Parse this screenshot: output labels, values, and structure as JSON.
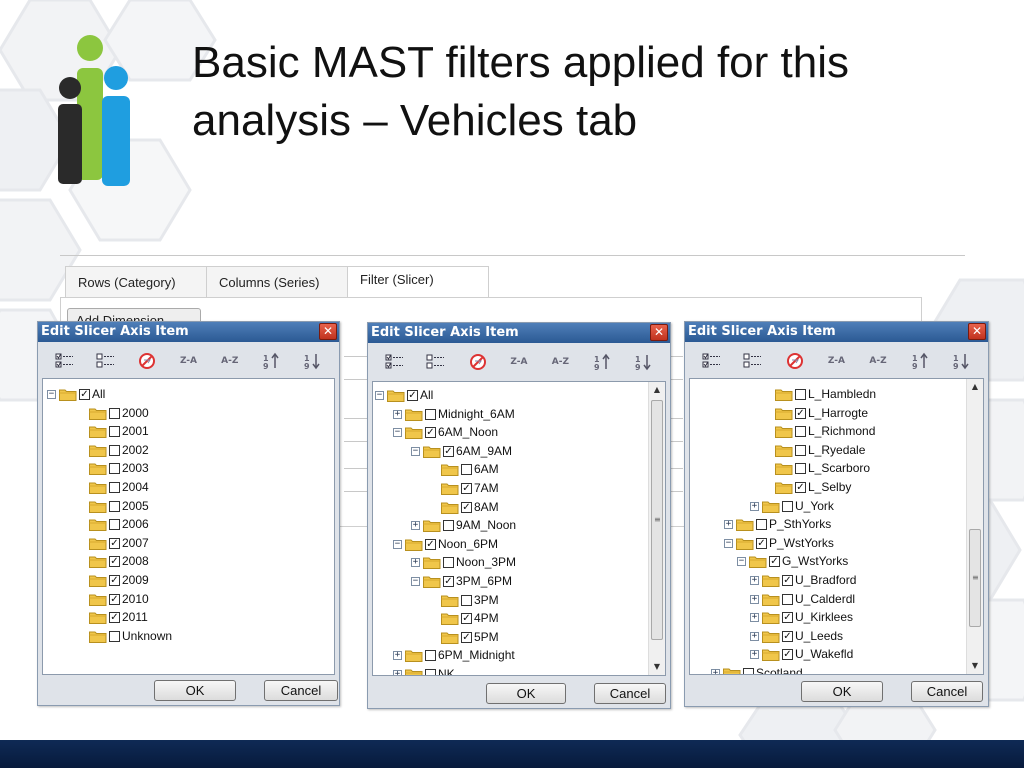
{
  "slide": {
    "title_line1": "Basic MAST filters applied for this",
    "title_line2": "analysis – Vehicles tab"
  },
  "colors": {
    "titlebar": "#3a6aa6",
    "footer": "#0b2248",
    "close": "#d44a32",
    "folder": "#f0c64a",
    "logo_green": "#8cc63f",
    "logo_blue": "#1f9ee0",
    "logo_dark": "#2a2a2a"
  },
  "background_panel": {
    "tabs": [
      "Rows (Category)",
      "Columns (Series)",
      "Filter (Slicer)"
    ],
    "add_dimension_label": "Add Dimension"
  },
  "dialogs": [
    {
      "title": "Edit Slicer Axis Item",
      "ok": "OK",
      "cancel": "Cancel",
      "rows": [
        {
          "label": "All",
          "indent": 0,
          "expander": "minus",
          "checked": true,
          "partial": true
        },
        {
          "label": "2000",
          "indent": 1,
          "expander": "none",
          "checked": false
        },
        {
          "label": "2001",
          "indent": 1,
          "expander": "none",
          "checked": false
        },
        {
          "label": "2002",
          "indent": 1,
          "expander": "none",
          "checked": false
        },
        {
          "label": "2003",
          "indent": 1,
          "expander": "none",
          "checked": false
        },
        {
          "label": "2004",
          "indent": 1,
          "expander": "none",
          "checked": false
        },
        {
          "label": "2005",
          "indent": 1,
          "expander": "none",
          "checked": false
        },
        {
          "label": "2006",
          "indent": 1,
          "expander": "none",
          "checked": false
        },
        {
          "label": "2007",
          "indent": 1,
          "expander": "none",
          "checked": true
        },
        {
          "label": "2008",
          "indent": 1,
          "expander": "none",
          "checked": true
        },
        {
          "label": "2009",
          "indent": 1,
          "expander": "none",
          "checked": true
        },
        {
          "label": "2010",
          "indent": 1,
          "expander": "none",
          "checked": true
        },
        {
          "label": "2011",
          "indent": 1,
          "expander": "none",
          "checked": true
        },
        {
          "label": "Unknown",
          "indent": 1,
          "expander": "none",
          "checked": false
        }
      ]
    },
    {
      "title": "Edit Slicer Axis Item",
      "ok": "OK",
      "cancel": "Cancel",
      "rows": [
        {
          "label": "All",
          "indent": 0,
          "expander": "minus",
          "checked": true,
          "partial": true
        },
        {
          "label": "Midnight_6AM",
          "indent": 1,
          "expander": "plus",
          "checked": false
        },
        {
          "label": "6AM_Noon",
          "indent": 1,
          "expander": "minus",
          "checked": true,
          "partial": true
        },
        {
          "label": "6AM_9AM",
          "indent": 2,
          "expander": "minus",
          "checked": true,
          "partial": true
        },
        {
          "label": "6AM",
          "indent": 3,
          "expander": "none",
          "checked": false
        },
        {
          "label": "7AM",
          "indent": 3,
          "expander": "none",
          "checked": true
        },
        {
          "label": "8AM",
          "indent": 3,
          "expander": "none",
          "checked": true
        },
        {
          "label": "9AM_Noon",
          "indent": 2,
          "expander": "plus",
          "checked": false
        },
        {
          "label": "Noon_6PM",
          "indent": 1,
          "expander": "minus",
          "checked": true,
          "partial": true
        },
        {
          "label": "Noon_3PM",
          "indent": 2,
          "expander": "plus",
          "checked": false
        },
        {
          "label": "3PM_6PM",
          "indent": 2,
          "expander": "minus",
          "checked": true,
          "partial": true
        },
        {
          "label": "3PM",
          "indent": 3,
          "expander": "none",
          "checked": false
        },
        {
          "label": "4PM",
          "indent": 3,
          "expander": "none",
          "checked": true
        },
        {
          "label": "5PM",
          "indent": 3,
          "expander": "none",
          "checked": true
        },
        {
          "label": "6PM_Midnight",
          "indent": 1,
          "expander": "plus",
          "checked": false
        },
        {
          "label": "NK",
          "indent": 1,
          "expander": "plus",
          "checked": false
        }
      ]
    },
    {
      "title": "Edit Slicer Axis Item",
      "ok": "OK",
      "cancel": "Cancel",
      "rows": [
        {
          "label": "L_Hambledn",
          "indent": 5,
          "expander": "none",
          "checked": false
        },
        {
          "label": "L_Harrogte",
          "indent": 5,
          "expander": "none",
          "checked": true
        },
        {
          "label": "L_Richmond",
          "indent": 5,
          "expander": "none",
          "checked": false
        },
        {
          "label": "L_Ryedale",
          "indent": 5,
          "expander": "none",
          "checked": false
        },
        {
          "label": "L_Scarboro",
          "indent": 5,
          "expander": "none",
          "checked": false
        },
        {
          "label": "L_Selby",
          "indent": 5,
          "expander": "none",
          "checked": true
        },
        {
          "label": "U_York",
          "indent": 4,
          "expander": "plus",
          "checked": false
        },
        {
          "label": "P_SthYorks",
          "indent": 2,
          "expander": "plus",
          "checked": false
        },
        {
          "label": "P_WstYorks",
          "indent": 2,
          "expander": "minus",
          "checked": true,
          "partial": true
        },
        {
          "label": "G_WstYorks",
          "indent": 3,
          "expander": "minus",
          "checked": true,
          "partial": true
        },
        {
          "label": "U_Bradford",
          "indent": 4,
          "expander": "plus",
          "checked": true
        },
        {
          "label": "U_Calderdl",
          "indent": 4,
          "expander": "plus",
          "checked": false
        },
        {
          "label": "U_Kirklees",
          "indent": 4,
          "expander": "plus",
          "checked": true
        },
        {
          "label": "U_Leeds",
          "indent": 4,
          "expander": "plus",
          "checked": true
        },
        {
          "label": "U_Wakefld",
          "indent": 4,
          "expander": "plus",
          "checked": true
        },
        {
          "label": "Scotland",
          "indent": 1,
          "expander": "plus",
          "checked": false
        }
      ]
    }
  ]
}
